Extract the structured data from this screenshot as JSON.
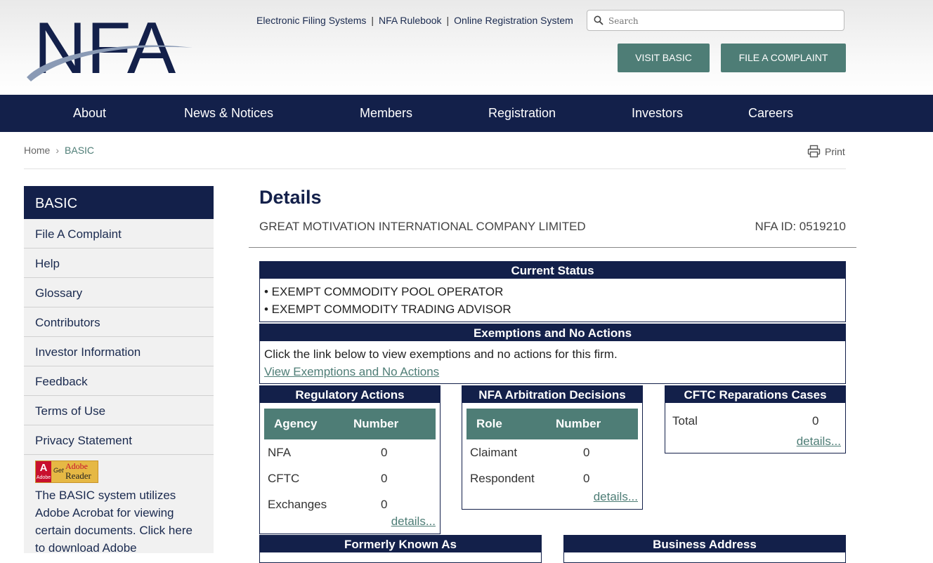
{
  "header": {
    "logo_text": "NFA",
    "utility_links": [
      "Electronic Filing Systems",
      "NFA Rulebook",
      "Online Registration System"
    ],
    "separator": "|",
    "search_placeholder": "Search",
    "visit_basic": "VISIT BASIC",
    "file_complaint": "FILE A COMPLAINT"
  },
  "nav": [
    "About",
    "News & Notices",
    "Members",
    "Registration",
    "Investors",
    "Careers"
  ],
  "breadcrumb": {
    "home": "Home",
    "current": "BASIC"
  },
  "print_label": "Print",
  "sidebar": {
    "title": "BASIC",
    "items": [
      "File A Complaint",
      "Help",
      "Glossary",
      "Contributors",
      "Investor Information",
      "Feedback",
      "Terms of Use",
      "Privacy Statement"
    ],
    "reader_badge": [
      "Adobe",
      "Get",
      "Adobe",
      "Reader"
    ],
    "reader_text": "The BASIC system utilizes Adobe Acrobat for viewing certain documents. Click here to download Adobe"
  },
  "main": {
    "title": "Details",
    "firm_name": "GREAT MOTIVATION INTERNATIONAL COMPANY LIMITED",
    "nfa_id": "NFA ID: 0519210",
    "current_status": {
      "title": "Current Status",
      "items": [
        "• EXEMPT COMMODITY POOL OPERATOR",
        "• EXEMPT COMMODITY TRADING ADVISOR"
      ]
    },
    "exemptions": {
      "title": "Exemptions and No Actions",
      "text": "Click the link below to view exemptions and no actions for this firm.",
      "link": "View Exemptions and No Actions"
    },
    "regulatory": {
      "title": "Regulatory Actions",
      "headers": [
        "Agency",
        "Number"
      ],
      "rows": [
        [
          "NFA",
          "0"
        ],
        [
          "CFTC",
          "0"
        ],
        [
          "Exchanges",
          "0"
        ]
      ],
      "details": "details..."
    },
    "arbitration": {
      "title": "NFA Arbitration Decisions",
      "headers": [
        "Role",
        "Number"
      ],
      "rows": [
        [
          "Claimant",
          "0"
        ],
        [
          "Respondent",
          "0"
        ]
      ],
      "details": "details..."
    },
    "cftc": {
      "title": "CFTC Reparations Cases",
      "label": "Total",
      "value": "0",
      "details": "details..."
    },
    "formerly_known_as": "Formerly Known As",
    "business_address": "Business Address"
  },
  "colors": {
    "navy": "#13204a",
    "green": "#4e7d76"
  }
}
